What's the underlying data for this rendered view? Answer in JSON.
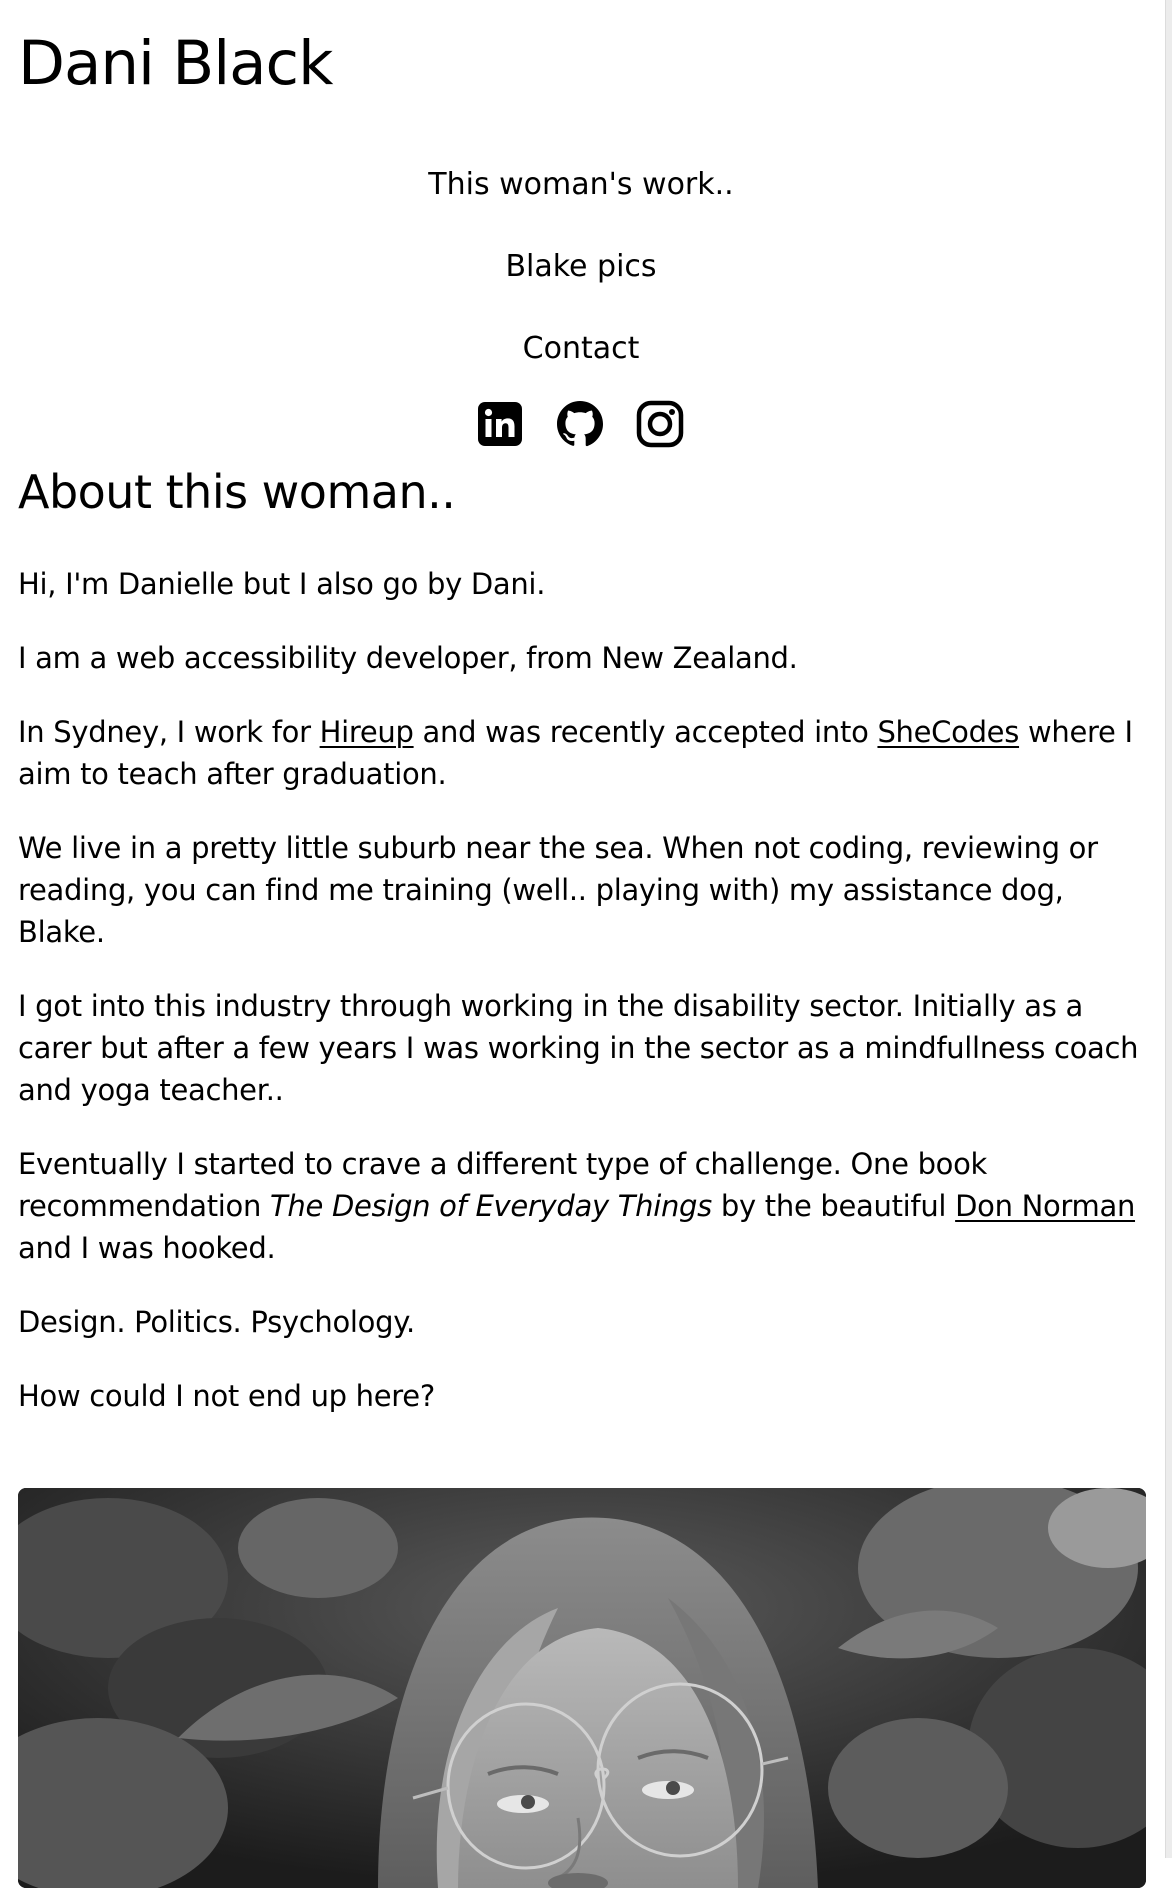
{
  "site": {
    "title": "Dani Black"
  },
  "nav": {
    "items": [
      {
        "label": "This woman's work.."
      },
      {
        "label": "Blake pics"
      },
      {
        "label": "Contact"
      }
    ]
  },
  "social": {
    "icons": [
      "linkedin-icon",
      "github-icon",
      "instagram-icon"
    ]
  },
  "about": {
    "heading": "About this woman..",
    "p1": "Hi, I'm Danielle but I also go by Dani.",
    "p2": "I am a web accessibility developer, from New Zealand.",
    "p3": {
      "before": "In Sydney, I work for ",
      "link1": "Hireup",
      "middle": " and was recently accepted into ",
      "link2": "SheCodes",
      "after": " where I aim to teach after graduation."
    },
    "p4": "We live in a pretty little suburb near the sea. When not coding, reviewing or reading, you can find me training (well.. playing with) my assistance dog, Blake.",
    "p5": "I got into this industry through working in the disability sector. Initially as a carer but after a few years I was working in the sector as a mindfullness coach and yoga teacher..",
    "p6": {
      "before": "Eventually I started to crave a different type of challenge. One book recommendation ",
      "book": "The Design of Everyday Things",
      "middle": " by the beautiful ",
      "link": "Don Norman",
      "after": " and I was hooked."
    },
    "p7": "Design. Politics. Psychology.",
    "p8": "How could I not end up here?"
  },
  "colors": {
    "text": "#000000",
    "background": "#ffffff"
  }
}
